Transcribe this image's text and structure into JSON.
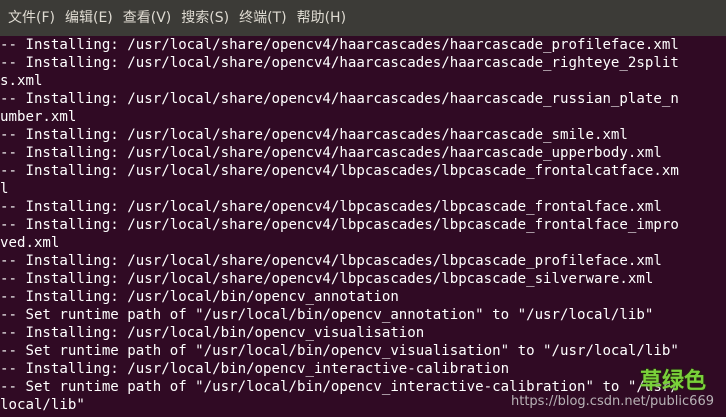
{
  "menu": {
    "items": [
      {
        "label": "文件(F)"
      },
      {
        "label": "编辑(E)"
      },
      {
        "label": "查看(V)"
      },
      {
        "label": "搜索(S)"
      },
      {
        "label": "终端(T)"
      },
      {
        "label": "帮助(H)"
      }
    ]
  },
  "terminal": {
    "lines": [
      "-- Installing: /usr/local/share/opencv4/haarcascades/haarcascade_profileface.xml",
      "-- Installing: /usr/local/share/opencv4/haarcascades/haarcascade_righteye_2split",
      "s.xml",
      "-- Installing: /usr/local/share/opencv4/haarcascades/haarcascade_russian_plate_n",
      "umber.xml",
      "-- Installing: /usr/local/share/opencv4/haarcascades/haarcascade_smile.xml",
      "-- Installing: /usr/local/share/opencv4/haarcascades/haarcascade_upperbody.xml",
      "-- Installing: /usr/local/share/opencv4/lbpcascades/lbpcascade_frontalcatface.xm",
      "l",
      "-- Installing: /usr/local/share/opencv4/lbpcascades/lbpcascade_frontalface.xml",
      "-- Installing: /usr/local/share/opencv4/lbpcascades/lbpcascade_frontalface_impro",
      "ved.xml",
      "-- Installing: /usr/local/share/opencv4/lbpcascades/lbpcascade_profileface.xml",
      "-- Installing: /usr/local/share/opencv4/lbpcascades/lbpcascade_silverware.xml",
      "-- Installing: /usr/local/bin/opencv_annotation",
      "-- Set runtime path of \"/usr/local/bin/opencv_annotation\" to \"/usr/local/lib\"",
      "-- Installing: /usr/local/bin/opencv_visualisation",
      "-- Set runtime path of \"/usr/local/bin/opencv_visualisation\" to \"/usr/local/lib\"",
      "-- Installing: /usr/local/bin/opencv_interactive-calibration",
      "-- Set runtime path of \"/usr/local/bin/opencv_interactive-calibration\" to \"/usr/",
      "local/lib\""
    ]
  },
  "watermark": {
    "brand": "草绿色",
    "url": "https://blog.csdn.net/public669"
  },
  "colors": {
    "background": "#300a24",
    "menubar": "#3c3b37",
    "menu_text": "#dfdbd2",
    "text": "#ffffff",
    "watermark_brand": "#7ad13a"
  }
}
